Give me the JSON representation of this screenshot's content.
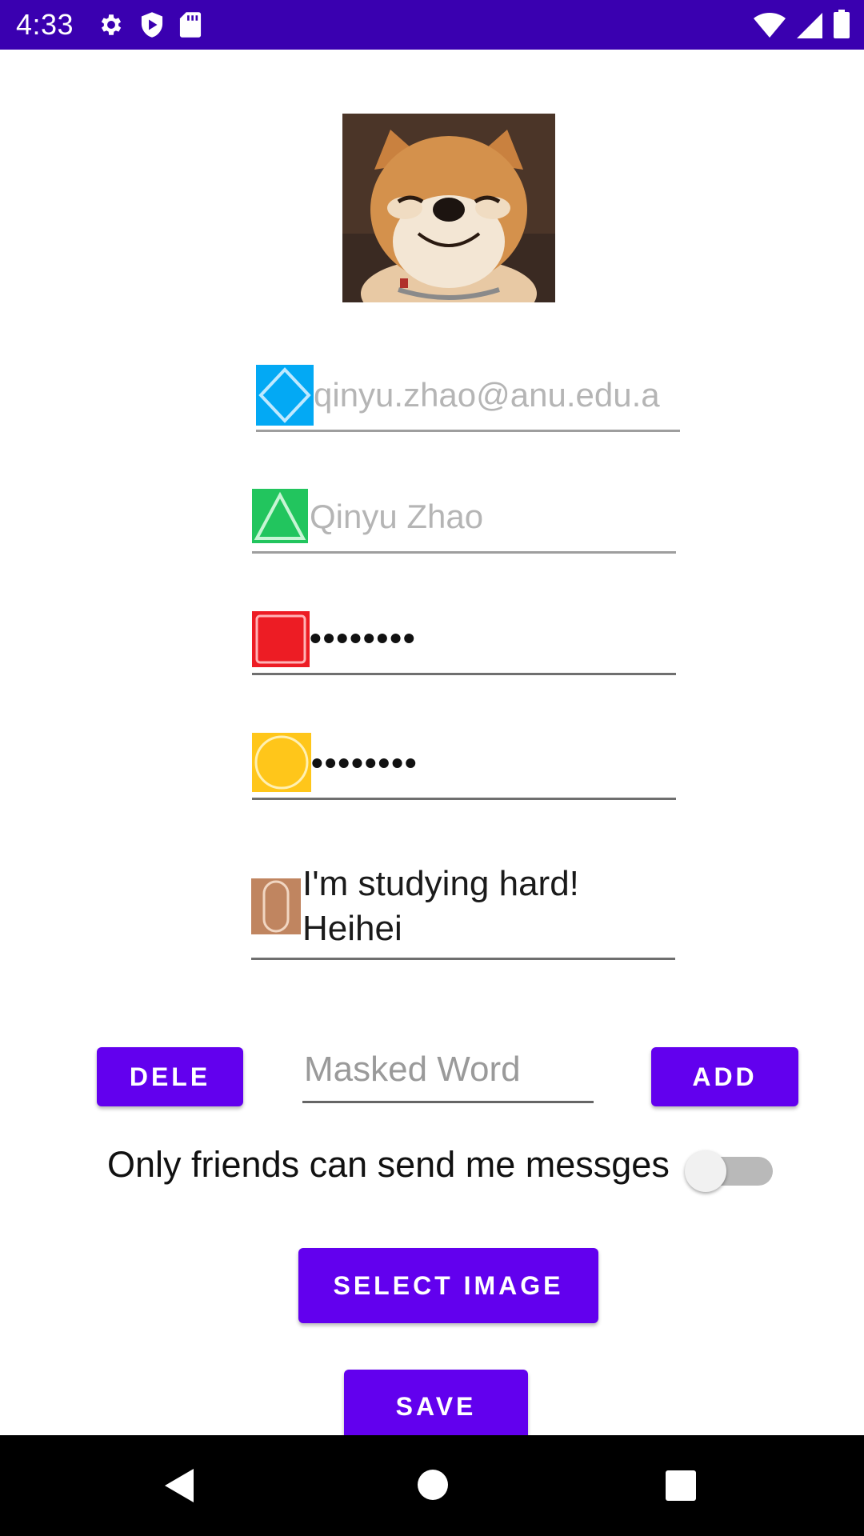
{
  "status_bar": {
    "time": "4:33",
    "left_icons": [
      "gear-icon",
      "shield-play-icon",
      "sd-card-icon"
    ],
    "right_icons": [
      "wifi-icon",
      "signal-icon",
      "battery-icon"
    ],
    "background": "#3a00b0"
  },
  "profile": {
    "avatar_description": "shiba-dog-photo"
  },
  "fields": {
    "email": {
      "value": "qinyu.zhao@anu.edu.a",
      "icon": "blue-diamond-icon",
      "accent": "#03a9f4"
    },
    "name": {
      "value": "Qinyu Zhao",
      "icon": "green-triangle-icon",
      "accent": "#22c55e"
    },
    "password": {
      "value": "••••••••",
      "icon": "red-square-icon",
      "accent": "#ed1c24"
    },
    "confirm_password": {
      "value": "••••••••",
      "icon": "yellow-circle-icon",
      "accent": "#ffc61a"
    },
    "status_line1": "I'm studying hard!",
    "status_line2": "Heihei",
    "status_icon": "brown-oval-icon"
  },
  "masked_word": {
    "delete_label": "DELE",
    "placeholder": "Masked Word",
    "add_label": "ADD"
  },
  "privacy": {
    "label": "Only friends can send me messges",
    "enabled": false
  },
  "actions": {
    "select_image": "SELECT IMAGE",
    "save": "SAVE"
  },
  "colors": {
    "primary": "#6200ee"
  },
  "nav_bar": {
    "icons": [
      "back-icon",
      "home-icon",
      "recents-icon"
    ]
  }
}
